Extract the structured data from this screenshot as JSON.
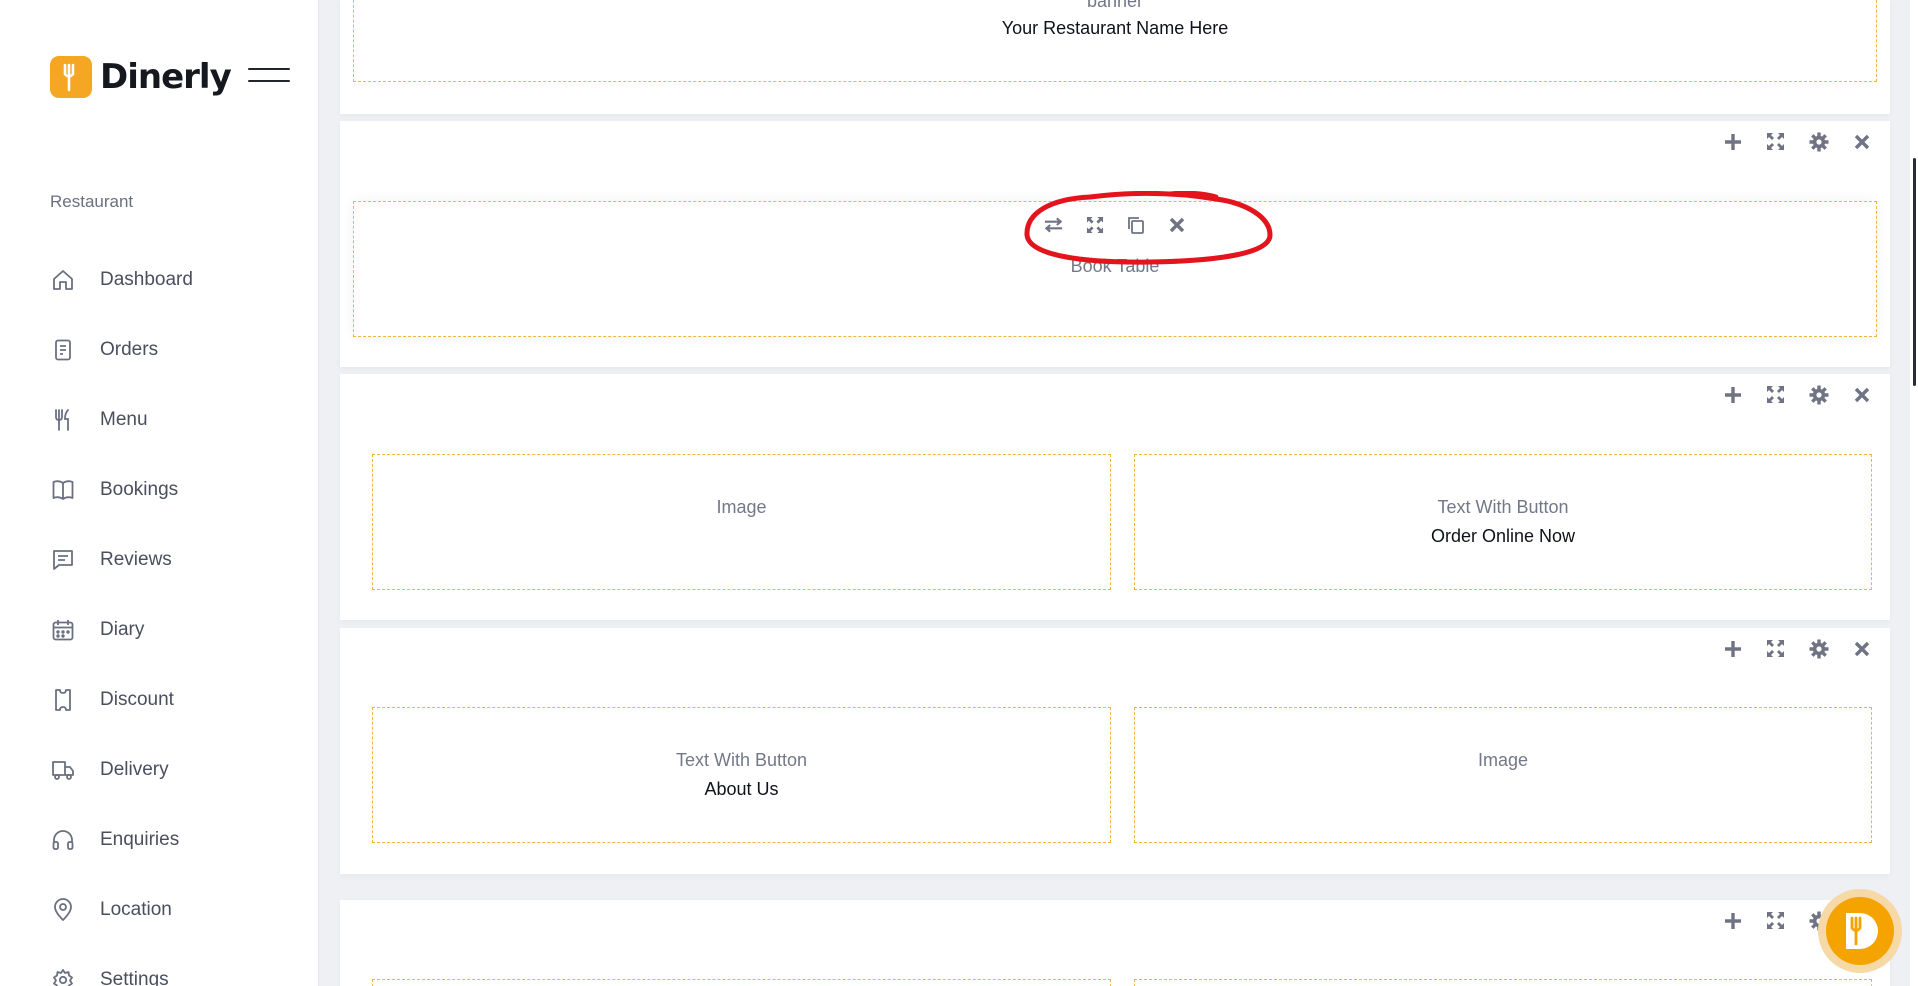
{
  "brand": {
    "name": "Dinerly",
    "accent": "#f5a623"
  },
  "sidebar": {
    "section_label": "Restaurant",
    "items": [
      {
        "label": "Dashboard",
        "icon": "home-icon"
      },
      {
        "label": "Orders",
        "icon": "receipt-icon"
      },
      {
        "label": "Menu",
        "icon": "fork-knife-icon"
      },
      {
        "label": "Bookings",
        "icon": "book-icon"
      },
      {
        "label": "Reviews",
        "icon": "message-lines-icon"
      },
      {
        "label": "Diary",
        "icon": "calendar-icon"
      },
      {
        "label": "Discount",
        "icon": "ticket-icon"
      },
      {
        "label": "Delivery",
        "icon": "truck-icon"
      },
      {
        "label": "Enquiries",
        "icon": "headset-icon"
      },
      {
        "label": "Location",
        "icon": "map-pin-icon"
      },
      {
        "label": "Settings",
        "icon": "gear-icon"
      }
    ]
  },
  "builder": {
    "rows": [
      {
        "blocks": [
          {
            "type": "banner",
            "title": "Your Restaurant Name Here"
          }
        ]
      },
      {
        "blocks": [
          {
            "type": "Book Table",
            "title": ""
          }
        ]
      },
      {
        "blocks": [
          {
            "type": "Image",
            "title": ""
          },
          {
            "type": "Text With Button",
            "title": "Order Online Now"
          }
        ]
      },
      {
        "blocks": [
          {
            "type": "Text With Button",
            "title": "About Us"
          },
          {
            "type": "Image",
            "title": ""
          }
        ]
      }
    ],
    "row_tools": [
      "plus-icon",
      "expand-icon",
      "gear-icon",
      "close-icon"
    ],
    "block_tools": [
      "swap-icon",
      "expand-icon",
      "copy-icon",
      "close-icon"
    ],
    "annotation_color": "#e3141b",
    "tool_color": "#6f7384",
    "dashed_border_color": "#f1b441"
  }
}
